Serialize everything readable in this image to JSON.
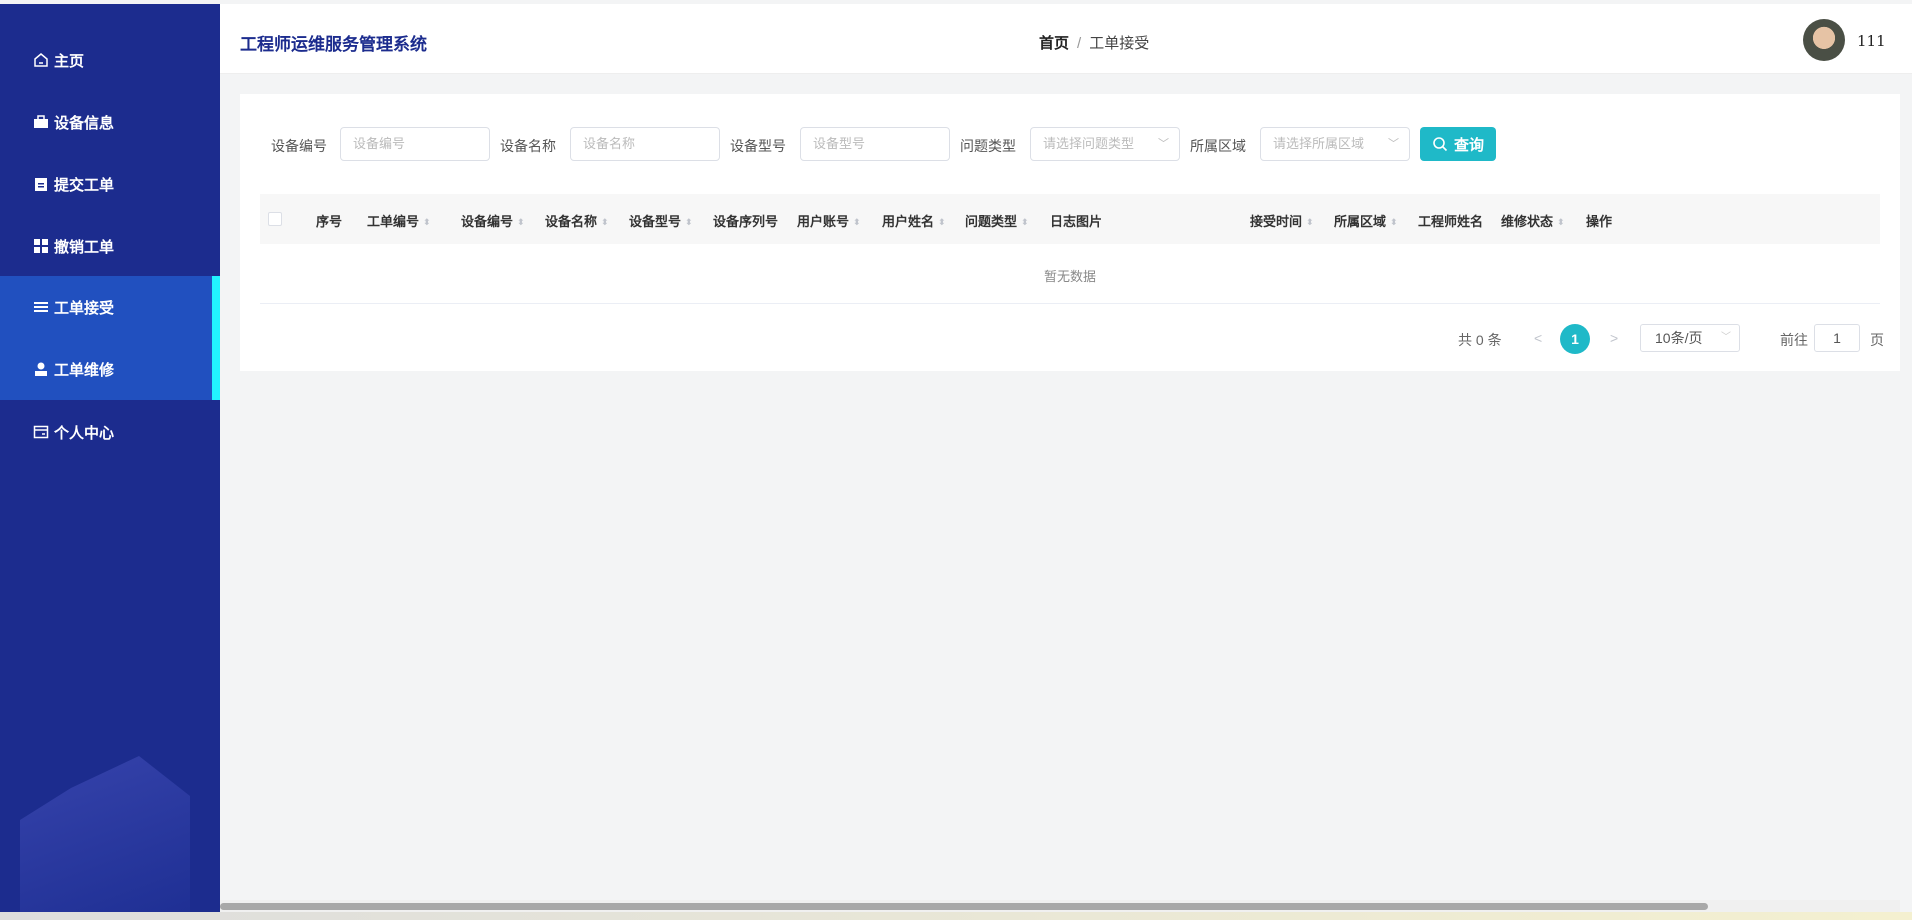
{
  "app_title": "工程师运维服务管理系统",
  "breadcrumb": {
    "home": "首页",
    "separator": "/",
    "current": "工单接受"
  },
  "user": {
    "name": "111"
  },
  "sidebar": {
    "items": [
      {
        "label": "主页",
        "icon": "home-icon"
      },
      {
        "label": "设备信息",
        "icon": "briefcase-icon"
      },
      {
        "label": "提交工单",
        "icon": "clipboard-icon"
      },
      {
        "label": "撤销工单",
        "icon": "grid-icon"
      },
      {
        "label": "工单接受",
        "icon": "list-icon",
        "active": true
      },
      {
        "label": "工单维修",
        "icon": "user-icon"
      },
      {
        "label": "个人中心",
        "icon": "card-icon"
      }
    ]
  },
  "filters": {
    "device_no": {
      "label": "设备编号",
      "placeholder": "设备编号"
    },
    "device_name": {
      "label": "设备名称",
      "placeholder": "设备名称"
    },
    "device_model": {
      "label": "设备型号",
      "placeholder": "设备型号"
    },
    "issue_type": {
      "label": "问题类型",
      "placeholder": "请选择问题类型"
    },
    "region": {
      "label": "所属区域",
      "placeholder": "请选择所属区域"
    },
    "search_label": "查询"
  },
  "table": {
    "columns": [
      "序号",
      "工单编号",
      "设备编号",
      "设备名称",
      "设备型号",
      "设备序列号",
      "用户账号",
      "用户姓名",
      "问题类型",
      "日志图片",
      "接受时间",
      "所属区域",
      "工程师姓名",
      "维修状态",
      "操作"
    ],
    "empty_text": "暂无数据"
  },
  "pagination": {
    "total": "共 0 条",
    "current_page": "1",
    "page_size": "10条/页",
    "goto_label": "前往",
    "goto_value": "1",
    "page_suffix": "页",
    "prev": "<",
    "next": ">"
  },
  "colors": {
    "sidebar": "#1c2c8e",
    "active": "#2150bf",
    "accent": "#1fb9c8",
    "indicator": "#22f2ff"
  }
}
